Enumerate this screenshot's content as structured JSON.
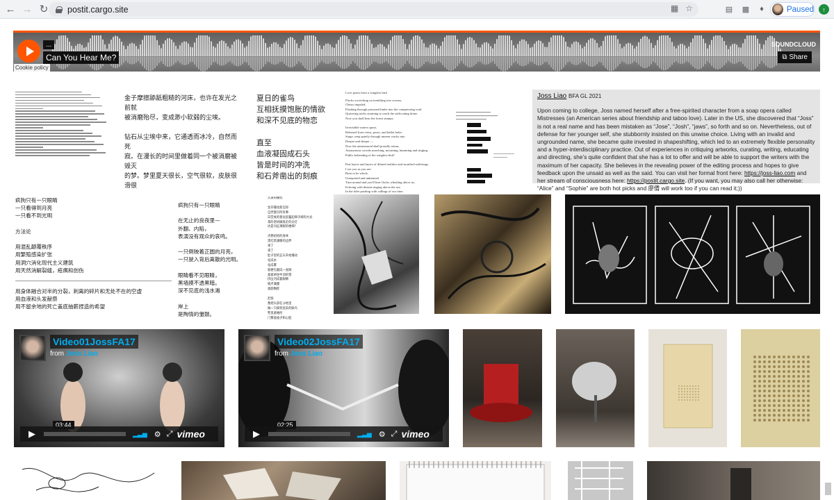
{
  "browser": {
    "url": "postit.cargo.site",
    "profile_label": "Paused",
    "extensions": [
      "translate-icon",
      "star-icon",
      "css-icon",
      "image-icon",
      "puzzle-icon"
    ]
  },
  "soundcloud": {
    "user": "...",
    "title": "Can You Hear Me?",
    "brand": "SOUNDCLOUD",
    "share": "Share",
    "cookie": "Cookie policy",
    "accent": "#ff5500"
  },
  "row1": {
    "cn_block_a": [
      "金子摩擦舔舐粗糙的河床，也许在发光之前就",
      "被消磨殆尽，变成渺小软弱的尘埃。",
      "",
      "钻石从尘埃中来，它通透而冰冷，自然而死",
      "寂。在漫长的时间里做着同一个被消磨被毁灭",
      "的梦。梦里夏天很长，空气很软，皮肤很滑很",
      "潮湿。金矿很温暖，在漫长的夜里唯一的光是",
      "它们在彼此身上的影子。",
      "",
      "在河岸的尽头，沙子，金子，钻石都奔涌向大",
      "海，以最平等的姿态。"
    ],
    "cn_block_b": [
      "夏日的雀鸟",
      "互相抚摸饱胀的情欲",
      "和深不见底的物恋",
      "",
      "直至",
      "血液凝固成石头",
      "皆是时间的冲洗",
      "和石斧凿出的刻痕"
    ],
    "en_poem_title": "Love poem from a wingless bird",
    "en_poem": [
      "Flocks screeching on trembling tree crowns,",
      "Chests impaled,",
      "Flashing through poisoned limbs into the compressing void.",
      "Quivering necks straining to reach the suffocating dome.",
      "Now you shall hear the forest stumps.",
      "",
      "Irresistible waters spout,",
      "Released from veins, pores, and bullet holes.",
      "Surge, seep quietly through unseen cracks into",
      "Deeper and deeper —",
      "Now the unmeasured shall proudly return,",
      "Anonymous crowds marching, mourning, humming and singing:",
      "Public beheading of the wingless bird!",
      "",
      "Past layers and layers of diluted realities and stratified sufferings,",
      "I see you as you are:",
      "Born to be whole,",
      "Unrepaired and unharmed",
      "Turn around and you'll hear flocks whistling above us,",
      "Echoing with distant singing above the sea.",
      "In the tides pushing with callings of our time,",
      "Rises the ark about to leave,",
      "Will you board with me?"
    ]
  },
  "bio": {
    "name": "Joss Liao",
    "tag": "BFA GL 2021",
    "body": "Upon coming to college, Joss named herself after a free-spirited character from a soap opera called Mistresses (an American series about friendship and taboo love). Later in the US, she discovered that “Joss” is not a real name and has been mistaken as “Jose”, “Josh”, “jaws”, so forth and so on. Nevertheless, out of defense for her younger self, she stubbornly insisted on this unwise choice. Living with an invalid and ungrounded name, she became quite invested in shapeshifting, which led to an extremely flexible personality and a hyper-interdisciplinary practice. Out of experiences in critiquing artworks, curating, writing, educating and directing, she’s quite confident that she has a lot to offer and will be able to support the writers with the maximum of her capacity. She believes in the revealing power of the editing process and hopes to give feedback upon the unsaid as well as the said. You can visit her formal front here: ",
    "link1": "https://joss-liao.com",
    "mid": " and her stream of consciousness here: ",
    "link2": "https://postit.cargo.site",
    "tail": ". (If you want, you may also call her otherwise: “Alice” and “Sophie” are both hot picks and 廖倩 will work too if you can read it;))"
  },
  "row2": {
    "poem_a1": [
      "疯狗只有一只眼睛",
      "一只看得到月亮",
      "一只看不到光明",
      "",
      "方法论",
      "",
      "用混乱颠覆秩序",
      "用繁殖感染扩张",
      "用洞穴消化现代主义建筑",
      "用天然消解裂缝，疮痍和创伤"
    ],
    "poem_a2": [
      "用身体融合对半的分裂，刺离的碎片和无处不在的空虚",
      "用血液和头发献祭",
      "用不留余地的死亡盖底抽薪捏造的希望"
    ],
    "poem_b": [
      "疯狗只有一只眼睛",
      "",
      "在无止的良夜里—",
      "外翻、内陷，",
      "表演没有观众的哀鸣。",
      "",
      "一只倒映着正圆的月亮，",
      "一只驶入背后离散的光明。",
      "",
      "眼睛看不见眼睛，",
      "黑墙摸不透黑暗。",
      "深不见底的浅水滩",
      "",
      "岸上",
      "是陶情的雏鼓。"
    ],
    "poem_c": [
      "久录的痛饥",
      "",
      "生存躁动焦信仰",
      "自然意识所有事",
      "日堂食的香溢里蓄起梯子姆的大光",
      "来的老树脚底走的尖灯",
      "达是司征淹眼的楼梯？",
      "",
      "点燃初初的身体",
      "黑红筑满暖的边界",
      "来了",
      "来了",
      "肚子里的五头升始播动",
      "化成水",
      "化成雾",
      "窗便先最成一张网",
      "紧紧将住牛羽的雪",
      "挤压河成着眼睛",
      "缝点满膜",
      "紧颜胸腔",
      "",
      "赶快",
      "我把头部在沙地里",
      "做一只踩到泥去的联鸟",
      "警里避难所",
      "门雾直插子和心脏"
    ]
  },
  "videos": [
    {
      "title": "Video01JossFA17",
      "from": "from",
      "author": "Joss Liao",
      "time": "03:44",
      "brand": "vimeo"
    },
    {
      "title": "Video02JossFA17",
      "from": "from",
      "author": "Joss Liao",
      "time": "02:25",
      "brand": "vimeo"
    }
  ],
  "colors": {
    "vimeo_blue": "#00adef",
    "bio_bg": "#e4e4e4"
  }
}
